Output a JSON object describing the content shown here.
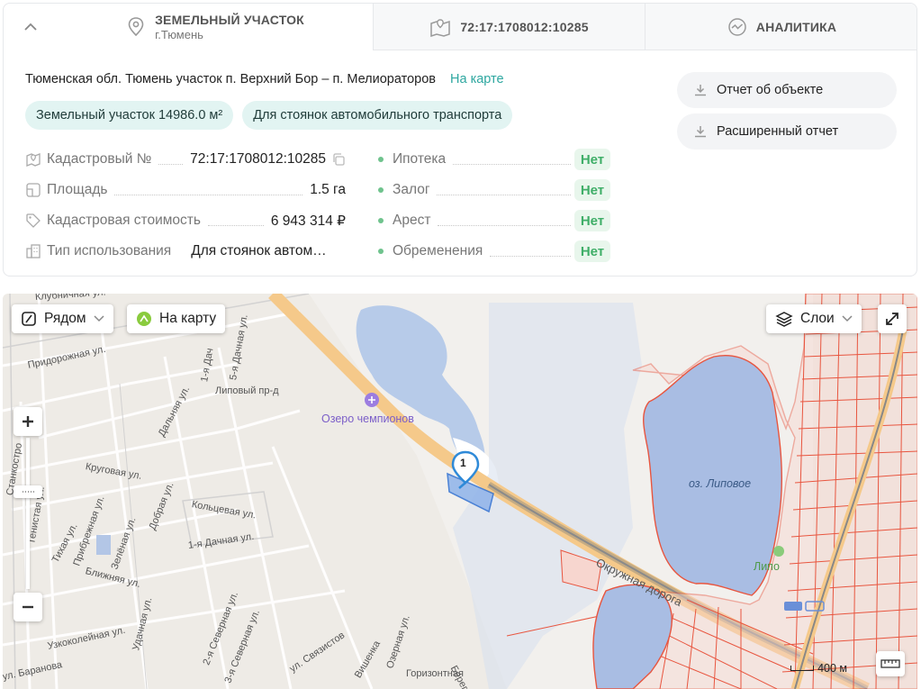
{
  "tabs": {
    "land": {
      "title": "ЗЕМЕЛЬНЫЙ УЧАСТОК",
      "subtitle": "г.Тюмень"
    },
    "cadastre": {
      "title": "72:17:1708012:10285"
    },
    "analytics": {
      "title": "АНАЛИТИКА"
    }
  },
  "address": {
    "text": "Тюменская обл. Тюмень участок п. Верхний Бор – п. Мелиораторов",
    "map_link": "На карте"
  },
  "chips": [
    "Земельный участок 14986.0 м²",
    "Для стоянок автомобильного транспорта"
  ],
  "properties": [
    {
      "label": "Кадастровый №",
      "value": "72:17:1708012:10285",
      "icon": "cadastre-icon"
    },
    {
      "label": "Площадь",
      "value": "1.5 га",
      "icon": "area-icon"
    },
    {
      "label": "Кадастровая стоимость",
      "value": "6 943 314 ₽",
      "icon": "price-tag-icon"
    },
    {
      "label": "Тип использования",
      "value": "Для стоянок автом…",
      "icon": "usage-icon"
    }
  ],
  "encumbrances": [
    {
      "label": "Ипотека",
      "value": "Нет"
    },
    {
      "label": "Залог",
      "value": "Нет"
    },
    {
      "label": "Арест",
      "value": "Нет"
    },
    {
      "label": "Обременения",
      "value": "Нет"
    }
  ],
  "reports": {
    "object": "Отчет об объекте",
    "extended": "Расширенный отчет"
  },
  "map": {
    "nearby": "Рядом",
    "to_map": "На карту",
    "layers": "Слои",
    "marker": "1",
    "scale": "400 м",
    "lake": "оз. Липовое",
    "poi": "Озеро чемпионов",
    "settlement": "Липо",
    "streets": [
      "Клубничная ул.",
      "Придорожная ул.",
      "Липовый пр-д",
      "Дальняя ул.",
      "Круговая ул.",
      "Кольцевая ул.",
      "1-я Дачная ул.",
      "Тенистая ул.",
      "Тихая ул.",
      "Прибрежная ул.",
      "Зелёная ул.",
      "Добрая ул.",
      "Ближняя ул.",
      "Удачная ул.",
      "Узкоколейная ул.",
      "2-я Северная ул.",
      "3-я Северная ул.",
      "ул. Связистов",
      "Вишенка",
      "Озерная ул.",
      "Горизонтная",
      "Береговая",
      "Окружная дорога",
      "ул. Баранова",
      "Станкостро",
      "5-я Дачная ул.",
      "1-я Дач"
    ]
  },
  "colors": {
    "accent": "#2ea7a0",
    "ok": "#3fae68",
    "cadastre_lines": "#e8553f",
    "water": "#b3c6e6"
  }
}
